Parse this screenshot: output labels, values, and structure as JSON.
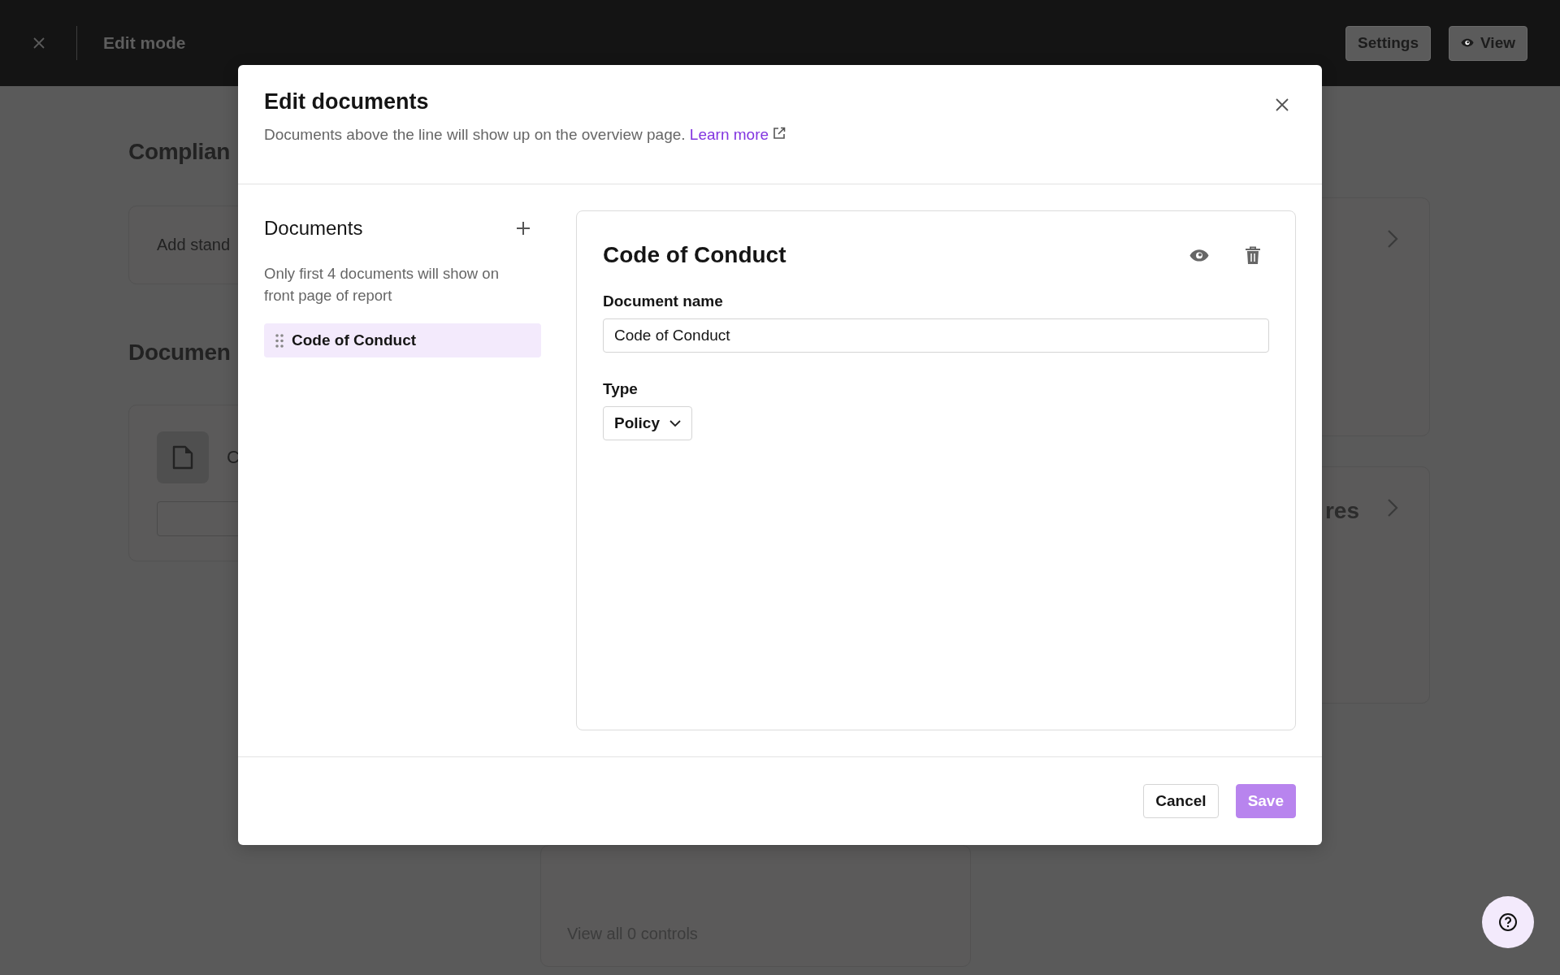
{
  "top_bar": {
    "title": "Edit mode",
    "buttons": [
      {
        "label": "Settings",
        "kind": "text"
      },
      {
        "label": "View",
        "kind": "icon"
      }
    ]
  },
  "background": {
    "section_1_heading": "Complian",
    "card_1_text": "Add stand",
    "section_2_heading": "Documen",
    "document_text": "C",
    "card_2_text": "res",
    "card_3_link": "View all 0 controls"
  },
  "dialog": {
    "title": "Edit documents",
    "subtitle": "Documents above the line will show up on the overview page.",
    "link": "Learn more",
    "sidebar": {
      "heading": "Documents",
      "note": "Only first 4 documents will show on front page of report",
      "items": [
        {
          "label": "Code of Conduct",
          "selected": true
        }
      ]
    },
    "detail": {
      "title": "Code of Conduct",
      "name_label": "Document name",
      "name_value": "Code of Conduct",
      "type_label": "Type",
      "type_value": "Policy"
    },
    "buttons": [
      {
        "label": "Cancel",
        "kind": "secondary",
        "disabled": false
      },
      {
        "label": "Save",
        "kind": "primary",
        "disabled": true
      }
    ]
  }
}
